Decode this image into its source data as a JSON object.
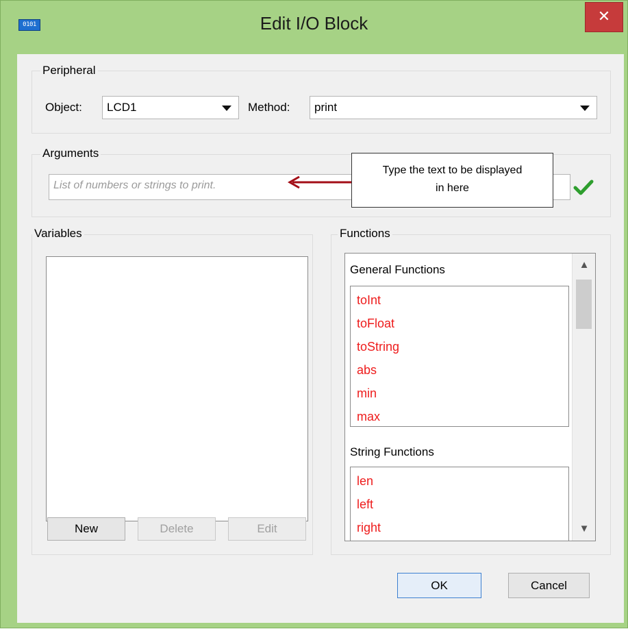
{
  "window": {
    "title": "Edit I/O Block",
    "app_icon_text": "0101",
    "close_symbol": "✕"
  },
  "peripheral": {
    "group_label": "Peripheral",
    "object_label": "Object:",
    "object_value": "LCD1",
    "method_label": "Method:",
    "method_value": "print"
  },
  "arguments": {
    "group_label": "Arguments",
    "placeholder": "List of numbers or strings to print.",
    "check_icon": "check-icon"
  },
  "annotation": {
    "line1": "Type the text to be displayed",
    "line2": "in here",
    "arrow_color": "#a30e17"
  },
  "variables": {
    "group_label": "Variables",
    "buttons": {
      "new": "New",
      "delete": "Delete",
      "edit": "Edit"
    }
  },
  "functions": {
    "group_label": "Functions",
    "sections": [
      {
        "name": "General Functions",
        "items": [
          "toInt",
          "toFloat",
          "toString",
          "abs",
          "min",
          "max"
        ]
      },
      {
        "name": "String Functions",
        "items": [
          "len",
          "left",
          "right"
        ]
      }
    ]
  },
  "footer": {
    "ok": "OK",
    "cancel": "Cancel"
  },
  "colors": {
    "title_bar": "#a6d285",
    "close_button": "#c63b3b",
    "function_text": "#ee1c1c",
    "check_green": "#2e9e2e"
  }
}
